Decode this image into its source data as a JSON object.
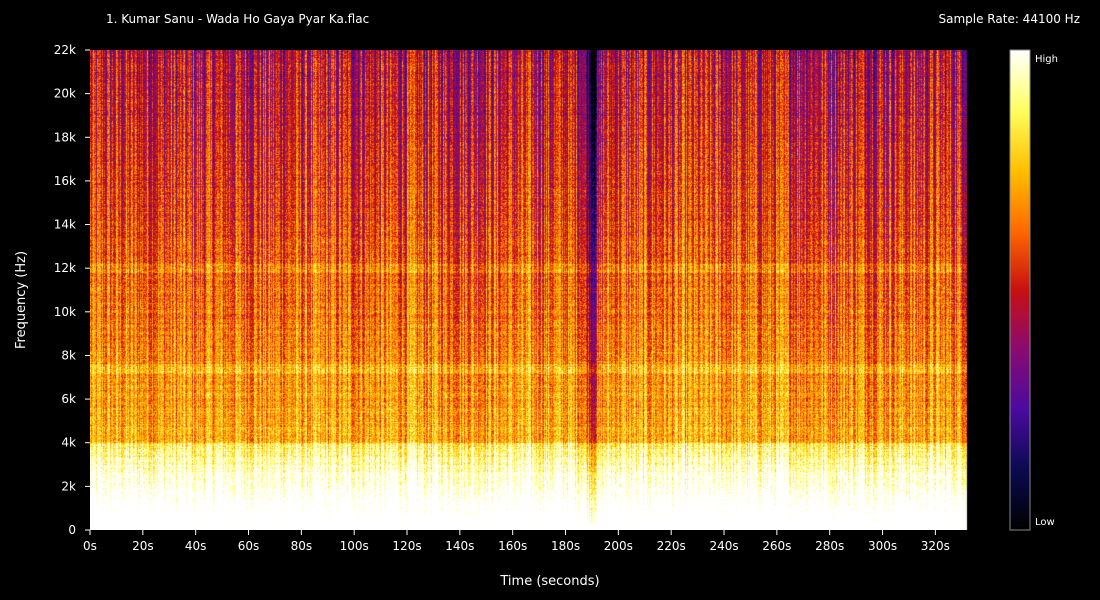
{
  "header": {
    "file_name": "1. Kumar Sanu - Wada Ho Gaya Pyar Ka.flac",
    "sample_rate": "Sample Rate: 44100 Hz"
  },
  "colors": {
    "background": "#000000",
    "text": "#ffffff",
    "colormap": [
      "#000000",
      "#0a0a50",
      "#4a0aa0",
      "#8a0a70",
      "#c81010",
      "#ff6a00",
      "#ffc000",
      "#ffff60",
      "#ffffff"
    ]
  },
  "chart_data": {
    "type": "heatmap",
    "title": "",
    "xlabel": "Time (seconds)",
    "ylabel": "Frequency (Hz)",
    "xlim": [
      0,
      335
    ],
    "ylim": [
      0,
      22000
    ],
    "x_ticks": [
      0,
      20,
      40,
      60,
      80,
      100,
      120,
      140,
      160,
      180,
      200,
      220,
      240,
      260,
      280,
      300,
      320
    ],
    "x_tick_labels": [
      "0s",
      "20s",
      "40s",
      "60s",
      "80s",
      "100s",
      "120s",
      "140s",
      "160s",
      "180s",
      "200s",
      "220s",
      "240s",
      "260s",
      "280s",
      "300s",
      "320s"
    ],
    "y_ticks": [
      0,
      2000,
      4000,
      6000,
      8000,
      10000,
      12000,
      14000,
      16000,
      18000,
      20000,
      22000
    ],
    "y_tick_labels": [
      "0",
      "2k",
      "4k",
      "6k",
      "8k",
      "10k",
      "12k",
      "14k",
      "16k",
      "18k",
      "20k",
      "22k"
    ],
    "colorbar_labels": {
      "high": "High",
      "low": "Low"
    },
    "features": {
      "dropout_time_s": 190,
      "harmonic_band_hz": [
        12000,
        7400
      ],
      "low_freq_energy_below_hz": 4000
    }
  }
}
